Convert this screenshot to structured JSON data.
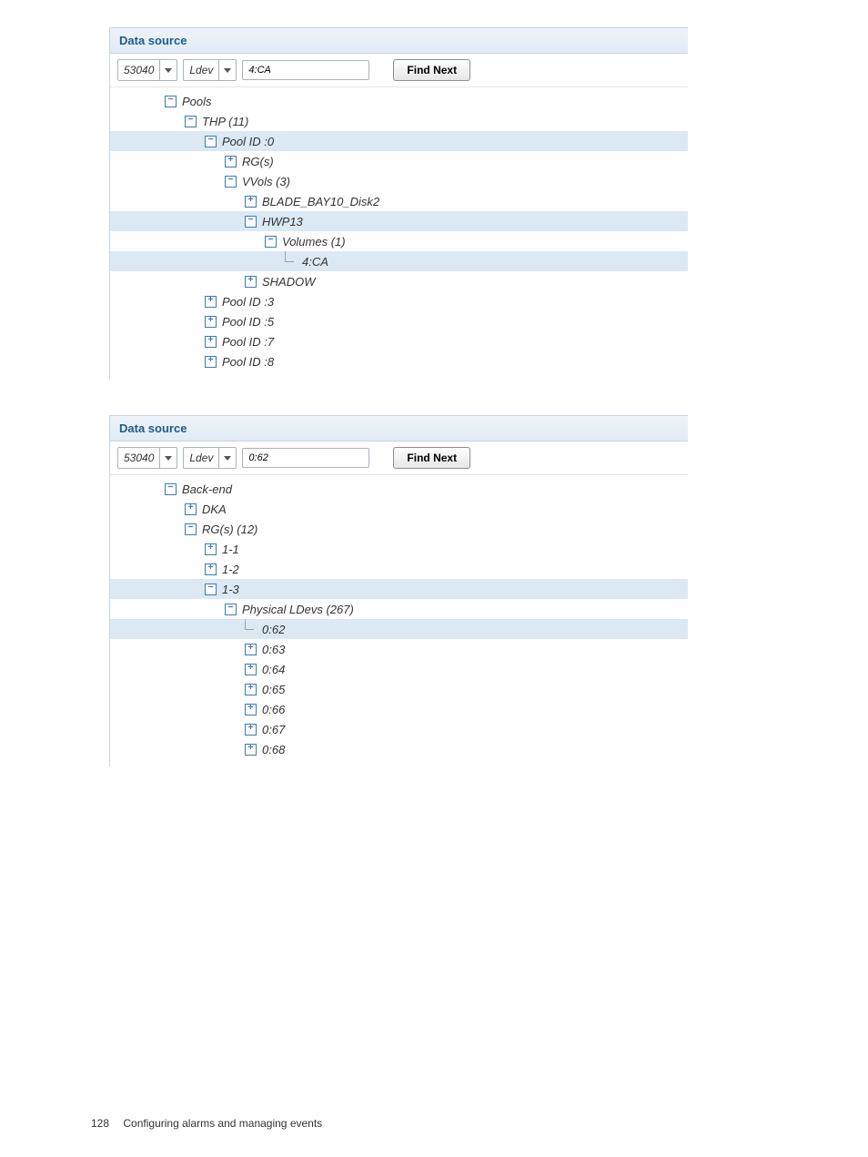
{
  "panel1": {
    "title": "Data source",
    "select1": "53040",
    "select2": "Ldev",
    "search": "4:CA",
    "find_btn": "Find Next",
    "rows": [
      {
        "indent": 1,
        "expander": "-",
        "label": "Pools",
        "hl": false,
        "name": "tree-pools"
      },
      {
        "indent": 2,
        "expander": "-",
        "label": "THP (11)",
        "hl": false,
        "name": "tree-thp"
      },
      {
        "indent": 3,
        "expander": "-",
        "label": "Pool ID :0",
        "hl": true,
        "name": "tree-pool-0"
      },
      {
        "indent": 4,
        "expander": "+",
        "label": "RG(s)",
        "hl": false,
        "name": "tree-rgs"
      },
      {
        "indent": 4,
        "expander": "-",
        "label": "VVols (3)",
        "hl": false,
        "name": "tree-vvols"
      },
      {
        "indent": 5,
        "expander": "+",
        "label": "BLADE_BAY10_Disk2",
        "hl": false,
        "name": "tree-blade"
      },
      {
        "indent": 5,
        "expander": "-",
        "label": "HWP13",
        "hl": true,
        "name": "tree-hwp13"
      },
      {
        "indent": 6,
        "expander": "-",
        "label": "Volumes (1)",
        "hl": false,
        "name": "tree-volumes"
      },
      {
        "indent": 7,
        "expander": "leaf",
        "label": "4:CA",
        "hl": true,
        "name": "tree-4ca"
      },
      {
        "indent": 5,
        "expander": "+",
        "label": "SHADOW",
        "hl": false,
        "name": "tree-shadow"
      },
      {
        "indent": 3,
        "expander": "+",
        "label": "Pool ID :3",
        "hl": false,
        "name": "tree-pool-3"
      },
      {
        "indent": 3,
        "expander": "+",
        "label": "Pool ID :5",
        "hl": false,
        "name": "tree-pool-5"
      },
      {
        "indent": 3,
        "expander": "+",
        "label": "Pool ID :7",
        "hl": false,
        "name": "tree-pool-7"
      },
      {
        "indent": 3,
        "expander": "+",
        "label": "Pool ID :8",
        "hl": false,
        "name": "tree-pool-8"
      }
    ]
  },
  "panel2": {
    "title": "Data source",
    "select1": "53040",
    "select2": "Ldev",
    "search": "0:62",
    "find_btn": "Find Next",
    "rows": [
      {
        "indent": 1,
        "expander": "-",
        "label": "Back-end",
        "hl": false,
        "name": "tree-backend"
      },
      {
        "indent": 2,
        "expander": "+",
        "label": "DKA",
        "hl": false,
        "name": "tree-dka"
      },
      {
        "indent": 2,
        "expander": "-",
        "label": "RG(s) (12)",
        "hl": false,
        "name": "tree-rgs-12"
      },
      {
        "indent": 3,
        "expander": "+",
        "label": "1-1",
        "hl": false,
        "name": "tree-1-1"
      },
      {
        "indent": 3,
        "expander": "+",
        "label": "1-2",
        "hl": false,
        "name": "tree-1-2"
      },
      {
        "indent": 3,
        "expander": "-",
        "label": "1-3",
        "hl": true,
        "name": "tree-1-3"
      },
      {
        "indent": 4,
        "expander": "-",
        "label": "Physical LDevs (267)",
        "hl": false,
        "name": "tree-physical-ldevs"
      },
      {
        "indent": 5,
        "expander": "leaf",
        "label": "0:62",
        "hl": true,
        "name": "tree-0-62"
      },
      {
        "indent": 5,
        "expander": "+",
        "label": "0:63",
        "hl": false,
        "name": "tree-0-63"
      },
      {
        "indent": 5,
        "expander": "+",
        "label": "0:64",
        "hl": false,
        "name": "tree-0-64"
      },
      {
        "indent": 5,
        "expander": "+",
        "label": "0:65",
        "hl": false,
        "name": "tree-0-65"
      },
      {
        "indent": 5,
        "expander": "+",
        "label": "0:66",
        "hl": false,
        "name": "tree-0-66"
      },
      {
        "indent": 5,
        "expander": "+",
        "label": "0:67",
        "hl": false,
        "name": "tree-0-67"
      },
      {
        "indent": 5,
        "expander": "+",
        "label": "0:68",
        "hl": false,
        "name": "tree-0-68"
      }
    ]
  },
  "footer": {
    "page": "128",
    "title": "Configuring alarms and managing events"
  }
}
